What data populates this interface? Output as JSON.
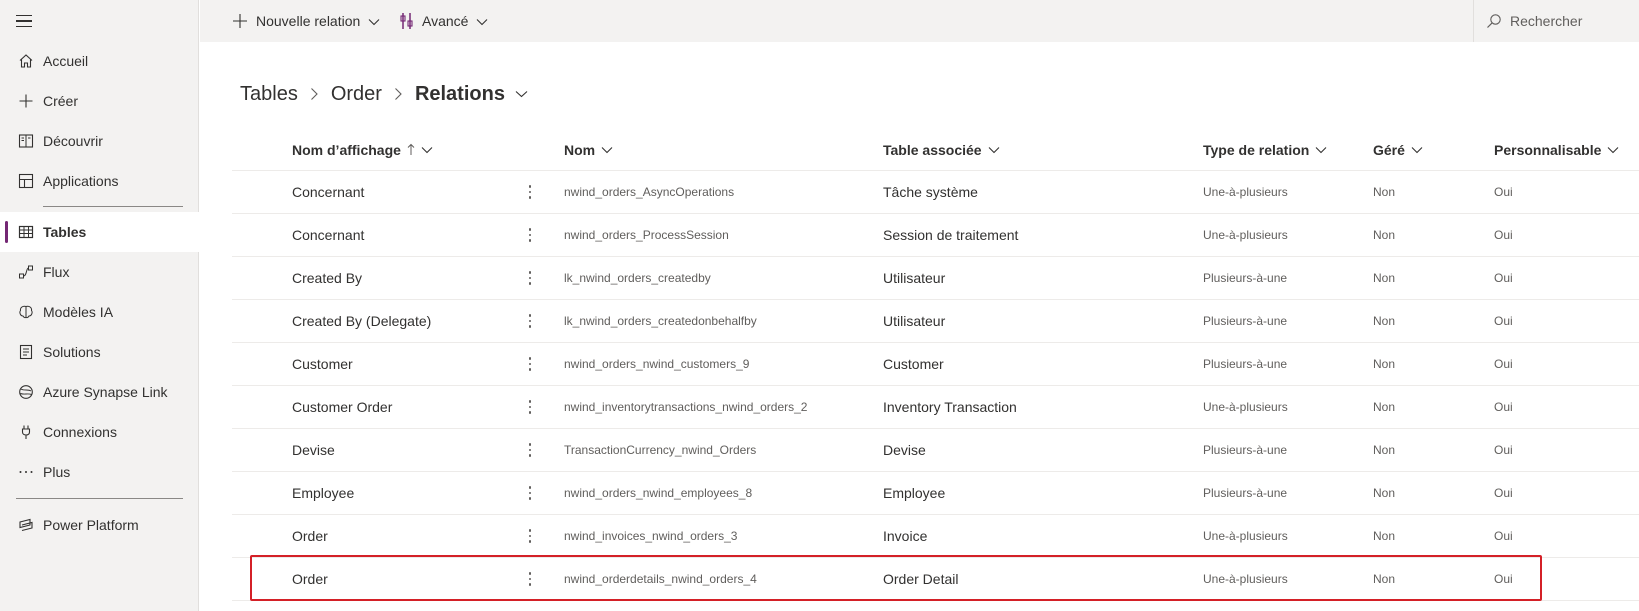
{
  "sidebar": {
    "items": [
      {
        "label": "Accueil",
        "icon": "home-icon"
      },
      {
        "label": "Créer",
        "icon": "plus-icon"
      },
      {
        "label": "Découvrir",
        "icon": "book-icon"
      },
      {
        "label": "Applications",
        "icon": "apps-icon"
      },
      {
        "label": "Tables",
        "icon": "table-icon",
        "active": true
      },
      {
        "label": "Flux",
        "icon": "flow-icon"
      },
      {
        "label": "Modèles IA",
        "icon": "brain-icon"
      },
      {
        "label": "Solutions",
        "icon": "solutions-icon"
      },
      {
        "label": "Azure Synapse Link",
        "icon": "synapse-icon"
      },
      {
        "label": "Connexions",
        "icon": "plug-icon"
      },
      {
        "label": "Plus",
        "icon": "ellipsis-icon"
      },
      {
        "label": "Power Platform",
        "icon": "power-platform-icon"
      }
    ]
  },
  "toolbar": {
    "new_relation_label": "Nouvelle relation",
    "advanced_label": "Avancé",
    "search_placeholder": "Rechercher"
  },
  "breadcrumb": {
    "items": [
      "Tables",
      "Order"
    ],
    "current": "Relations"
  },
  "table": {
    "columns": [
      "Nom d’affichage",
      "Nom",
      "Table associée",
      "Type de relation",
      "Géré",
      "Personnalisable"
    ],
    "rows": [
      {
        "display": "Concernant",
        "name": "nwind_orders_AsyncOperations",
        "table": "Tâche système",
        "type": "Une-à-plusieurs",
        "managed": "Non",
        "custom": "Oui"
      },
      {
        "display": "Concernant",
        "name": "nwind_orders_ProcessSession",
        "table": "Session de traitement",
        "type": "Une-à-plusieurs",
        "managed": "Non",
        "custom": "Oui"
      },
      {
        "display": "Created By",
        "name": "lk_nwind_orders_createdby",
        "table": "Utilisateur",
        "type": "Plusieurs-à-une",
        "managed": "Non",
        "custom": "Oui"
      },
      {
        "display": "Created By (Delegate)",
        "name": "lk_nwind_orders_createdonbehalfby",
        "table": "Utilisateur",
        "type": "Plusieurs-à-une",
        "managed": "Non",
        "custom": "Oui"
      },
      {
        "display": "Customer",
        "name": "nwind_orders_nwind_customers_9",
        "table": "Customer",
        "type": "Plusieurs-à-une",
        "managed": "Non",
        "custom": "Oui"
      },
      {
        "display": "Customer Order",
        "name": "nwind_inventorytransactions_nwind_orders_2",
        "table": "Inventory Transaction",
        "type": "Une-à-plusieurs",
        "managed": "Non",
        "custom": "Oui"
      },
      {
        "display": "Devise",
        "name": "TransactionCurrency_nwind_Orders",
        "table": "Devise",
        "type": "Plusieurs-à-une",
        "managed": "Non",
        "custom": "Oui"
      },
      {
        "display": "Employee",
        "name": "nwind_orders_nwind_employees_8",
        "table": "Employee",
        "type": "Plusieurs-à-une",
        "managed": "Non",
        "custom": "Oui"
      },
      {
        "display": "Order",
        "name": "nwind_invoices_nwind_orders_3",
        "table": "Invoice",
        "type": "Une-à-plusieurs",
        "managed": "Non",
        "custom": "Oui"
      },
      {
        "display": "Order",
        "name": "nwind_orderdetails_nwind_orders_4",
        "table": "Order Detail",
        "type": "Une-à-plusieurs",
        "managed": "Non",
        "custom": "Oui"
      }
    ]
  },
  "colors": {
    "accent": "#742774",
    "highlight": "#d42027"
  }
}
